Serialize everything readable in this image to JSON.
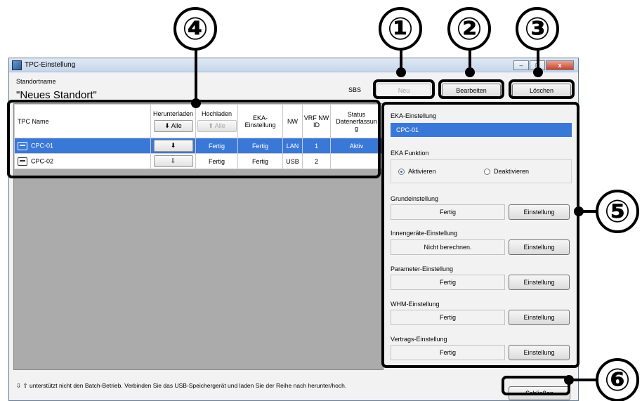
{
  "window": {
    "title": "TPC-Einstellung",
    "minimize": "–",
    "maximize": "□",
    "close": "x"
  },
  "standort": {
    "label": "Standortname",
    "value": "\"Neues Standort\"",
    "sbs": "SBS"
  },
  "toolbar": {
    "new_label": "Neu",
    "edit_label": "Bearbeiten",
    "delete_label": "Löschen"
  },
  "table": {
    "headers": {
      "name": "TPC Name",
      "download": "Herunterladen",
      "upload": "Hochladen",
      "eka_1": "EKA-",
      "eka_2": "Einstellung",
      "nw": "NW",
      "vrf_1": "VRF NW",
      "vrf_2": "ID",
      "status_1": "Status",
      "status_2": "Datenerfassun",
      "status_3": "g"
    },
    "download_all": "⬇ Alle",
    "upload_all": "⬆ Alle",
    "rows": [
      {
        "name": "CPC-01",
        "download": "⬇",
        "upload": "Fertig",
        "eka": "Fertig",
        "nw": "LAN",
        "vrf": "1",
        "status": "Aktiv"
      },
      {
        "name": "CPC-02",
        "download": "⇩",
        "upload": "Fertig",
        "eka": "Fertig",
        "nw": "USB",
        "vrf": "2",
        "status": ""
      }
    ]
  },
  "panel": {
    "eka_label": "EKA-Einstellung",
    "eka_value": "CPC-01",
    "function_label": "EKA Funktion",
    "activate": "Aktivieren",
    "deactivate": "Deaktivieren",
    "sections": [
      {
        "label": "Grundeinstellung",
        "value": "Fertig",
        "button": "Einstellung"
      },
      {
        "label": "Innengeräte-Einstellung",
        "value": "Nicht berechnen.",
        "button": "Einstellung"
      },
      {
        "label": "Parameter-Einstellung",
        "value": "Fertig",
        "button": "Einstellung"
      },
      {
        "label": "WHM-Einstellung",
        "value": "Fertig",
        "button": "Einstellung"
      },
      {
        "label": "Vertrags-Einstellung",
        "value": "Fertig",
        "button": "Einstellung"
      }
    ]
  },
  "footer": {
    "note": "⇩ ⇧  unterstützt nicht den Batch-Betrieb. Verbinden Sie das USB-Speichergerät und laden Sie der Reihe nach herunter/hoch.",
    "close_label": "Schließen"
  },
  "callouts": [
    "①",
    "②",
    "③",
    "④",
    "⑤",
    "⑥"
  ]
}
